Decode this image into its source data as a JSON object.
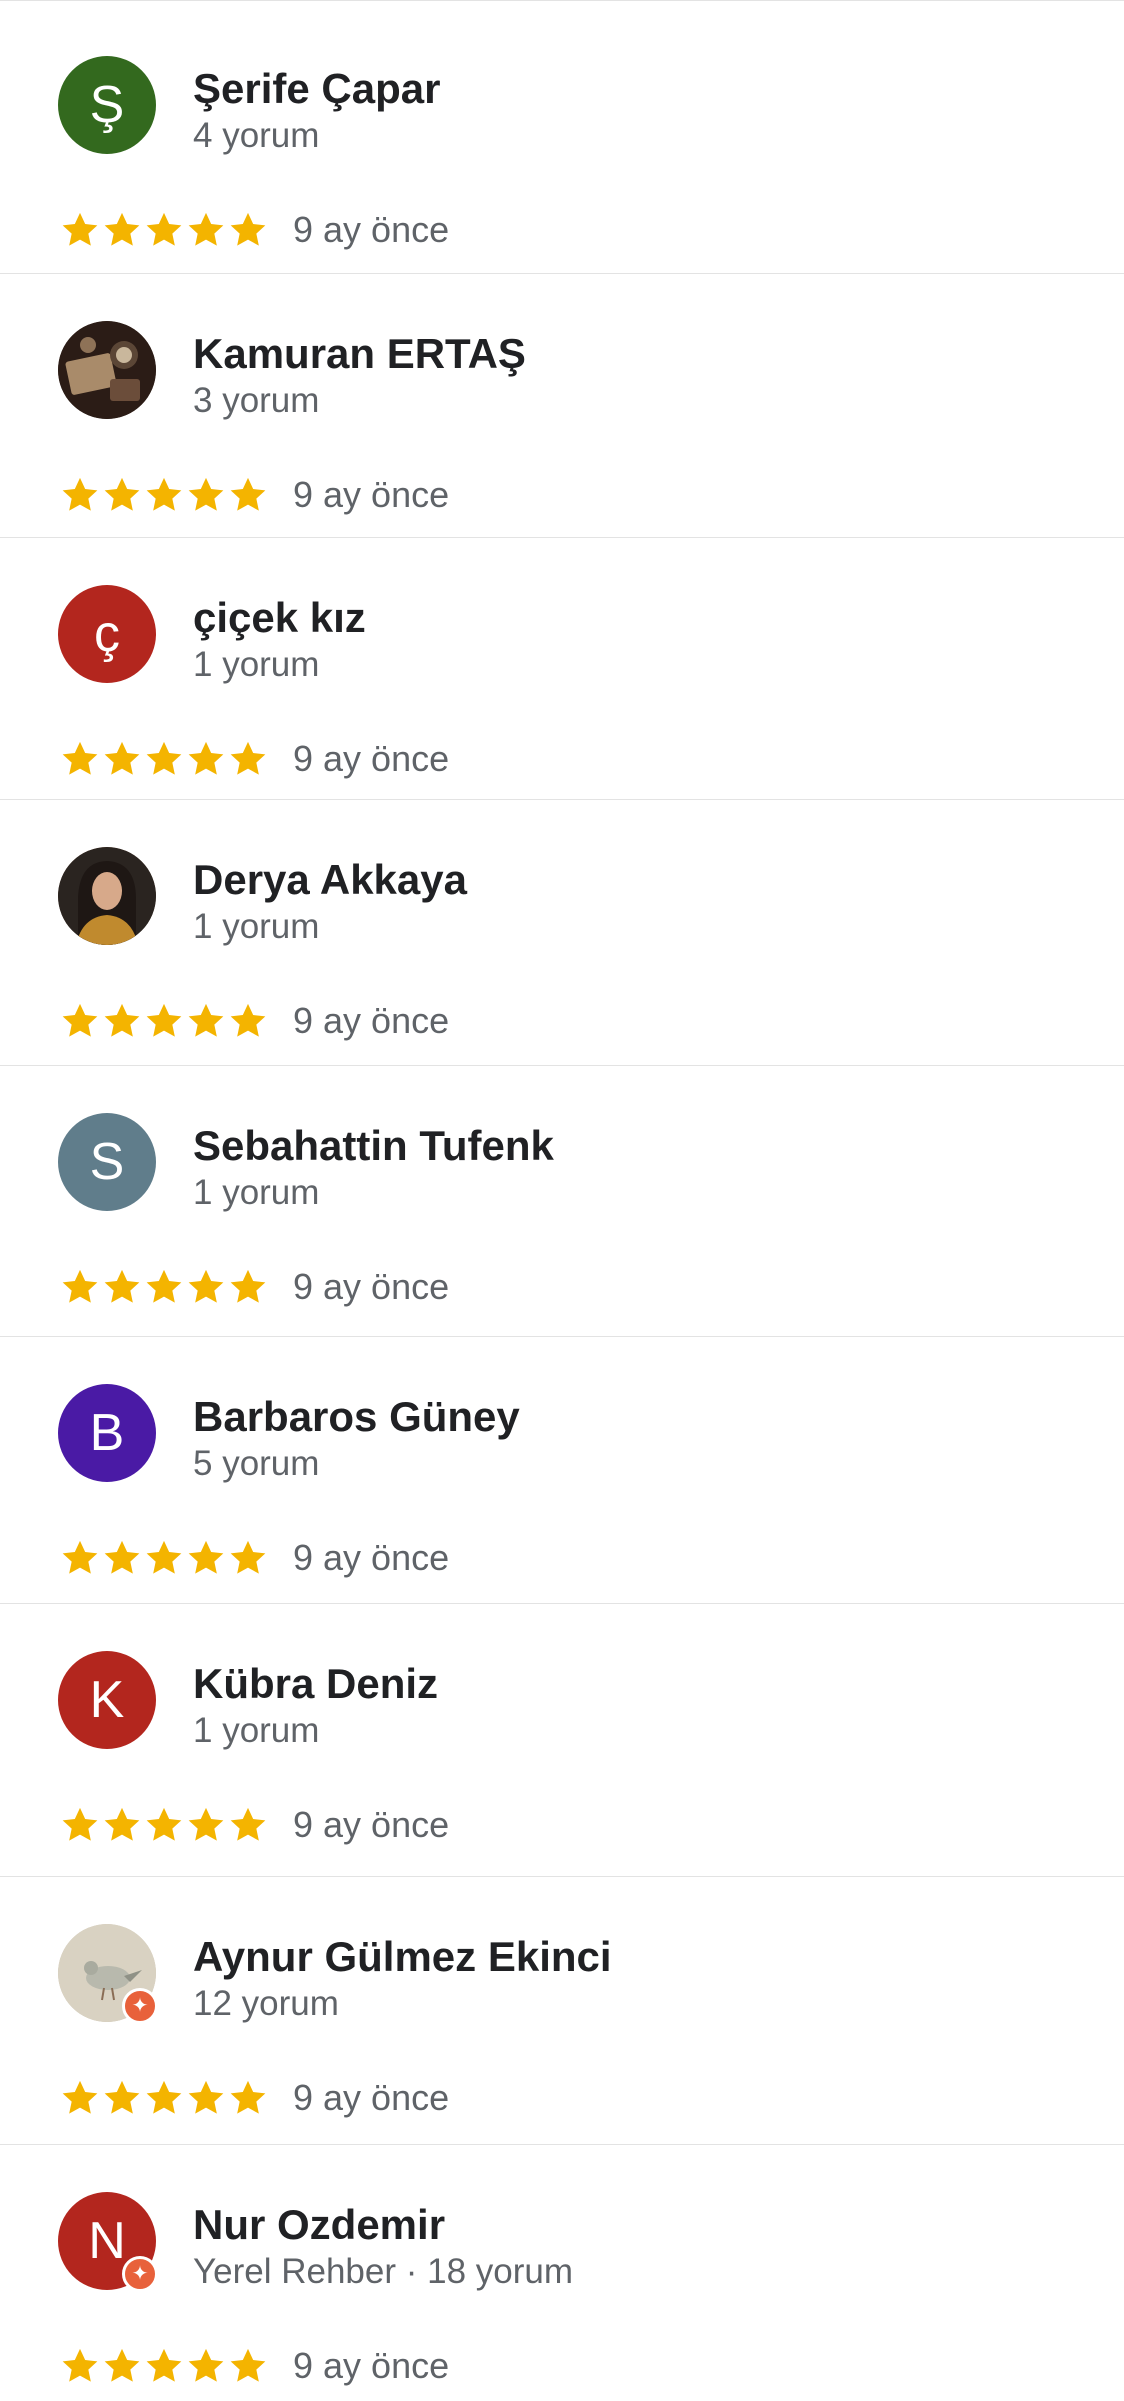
{
  "reviews": [
    {
      "name": "Şerife Çapar",
      "meta": "4 yorum",
      "avatar_letter": "Ş",
      "avatar_color": "#33691e",
      "rating": 5,
      "time": "9 ay önce"
    },
    {
      "name": "Kamuran ERTAŞ",
      "meta": "3 yorum",
      "avatar_letter": "",
      "avatar_color": "#3e2a1f",
      "rating": 5,
      "time": "9 ay önce"
    },
    {
      "name": "çiçek kız",
      "meta": "1 yorum",
      "avatar_letter": "ç",
      "avatar_color": "#b3261e",
      "rating": 5,
      "time": "9 ay önce"
    },
    {
      "name": "Derya Akkaya",
      "meta": "1 yorum",
      "avatar_letter": "",
      "avatar_color": "#3c2d22",
      "rating": 5,
      "time": "9 ay önce"
    },
    {
      "name": "Sebahattin Tufenk",
      "meta": "1 yorum",
      "avatar_letter": "S",
      "avatar_color": "#607d8b",
      "rating": 5,
      "time": "9 ay önce"
    },
    {
      "name": "Barbaros Güney",
      "meta": "5 yorum",
      "avatar_letter": "B",
      "avatar_color": "#4a1aa5",
      "rating": 5,
      "time": "9 ay önce"
    },
    {
      "name": "Kübra Deniz",
      "meta": "1 yorum",
      "avatar_letter": "K",
      "avatar_color": "#b3261e",
      "rating": 5,
      "time": "9 ay önce"
    },
    {
      "name": "Aynur Gülmez Ekinci",
      "meta": "12 yorum",
      "avatar_letter": "",
      "avatar_color": "#cfc6b1",
      "rating": 5,
      "time": "9 ay önce",
      "local_guide": true
    },
    {
      "name": "Nur Ozdemir",
      "meta": "Yerel Rehber · 18 yorum",
      "avatar_letter": "N",
      "avatar_color": "#b3261e",
      "rating": 5,
      "time": "9 ay önce",
      "local_guide": true
    }
  ],
  "colors": {
    "star": "#f4b400",
    "divider": "#e3e3e3",
    "name_text": "#202124",
    "meta_text": "#5f6368",
    "local_guide_badge": "#e8613b"
  },
  "icons": {
    "star": "star-icon",
    "local_guide_badge": "local-guide-badge-icon"
  }
}
